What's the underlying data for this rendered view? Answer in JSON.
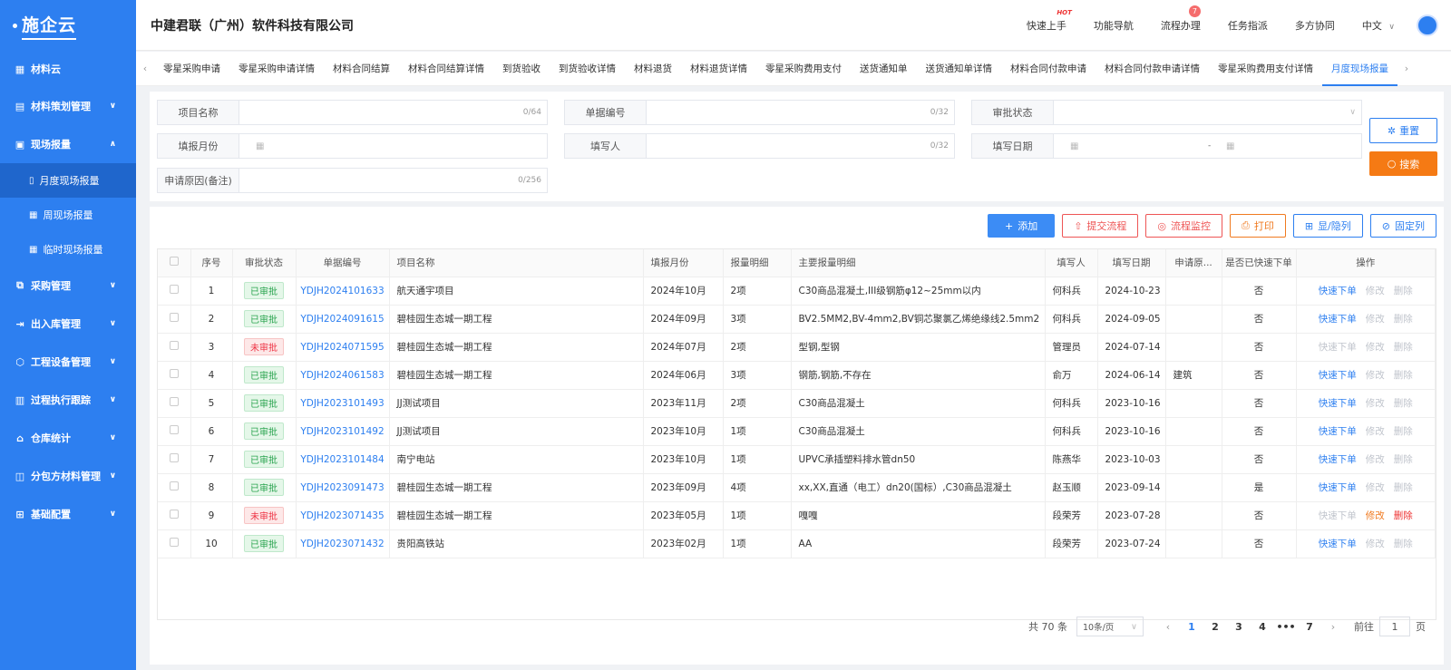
{
  "app": {
    "logo": "施企云",
    "company": "中建君联（广州）软件科技有限公司"
  },
  "header": {
    "items": [
      "快速上手",
      "功能导航",
      "流程办理",
      "任务指派",
      "多方协同"
    ],
    "hot_label": "HOT",
    "badge_count": "7",
    "language": "中文"
  },
  "sidebar": {
    "top": "材料云",
    "items": [
      "材料策划管理",
      "现场报量",
      "采购管理",
      "出入库管理",
      "工程设备管理",
      "过程执行跟踪",
      "仓库统计",
      "分包方材料管理",
      "基础配置"
    ],
    "subitems": [
      "月度现场报量",
      "周现场报量",
      "临时现场报量"
    ]
  },
  "tabs": [
    "零星采购申请",
    "零星采购申请详情",
    "材料合同结算",
    "材料合同结算详情",
    "到货验收",
    "到货验收详情",
    "材料退货",
    "材料退货详情",
    "零星采购费用支付",
    "送货通知单",
    "送货通知单详情",
    "材料合同付款申请",
    "材料合同付款申请详情",
    "零星采购费用支付详情",
    "月度现场报量"
  ],
  "filters": {
    "project_name": "项目名称",
    "project_count": "0/64",
    "doc_no": "单据编号",
    "doc_count": "0/32",
    "approval_status": "审批状态",
    "month": "填报月份",
    "filler": "填写人",
    "filler_count": "0/32",
    "fill_date": "填写日期",
    "date_sep": "-",
    "reason": "申请原因(备注)",
    "reason_count": "0/256",
    "reset": "重置",
    "search": "搜索"
  },
  "toolbar": {
    "add": "添加",
    "submit": "提交流程",
    "monitor": "流程监控",
    "print": "打印",
    "toggle": "显/隐列",
    "fix": "固定列"
  },
  "table": {
    "headers": [
      "序号",
      "审批状态",
      "单据编号",
      "项目名称",
      "填报月份",
      "报量明细",
      "主要报量明细",
      "填写人",
      "填写日期",
      "申请原...",
      "是否已快速下单",
      "操作"
    ],
    "actions": [
      "快速下单",
      "修改",
      "删除"
    ],
    "rows": [
      {
        "n": "1",
        "status": "已审批",
        "no": "YDJH2024101633",
        "project": "航天通宇项目",
        "month": "2024年10月",
        "qty": "2项",
        "detail": "C30商品混凝土,III级钢筋φ12~25mm以内",
        "filler": "何科兵",
        "date": "2024-10-23",
        "reason": "",
        "quick": "否"
      },
      {
        "n": "2",
        "status": "已审批",
        "no": "YDJH2024091615",
        "project": "碧桂园生态城一期工程",
        "month": "2024年09月",
        "qty": "3项",
        "detail": "BV2.5MM2,BV-4mm2,BV铜芯聚氯乙烯绝缘线2.5mm2",
        "filler": "何科兵",
        "date": "2024-09-05",
        "reason": "",
        "quick": "否"
      },
      {
        "n": "3",
        "status": "未审批",
        "no": "YDJH2024071595",
        "project": "碧桂园生态城一期工程",
        "month": "2024年07月",
        "qty": "2项",
        "detail": "型钢,型钢",
        "filler": "管理员",
        "date": "2024-07-14",
        "reason": "",
        "quick": "否"
      },
      {
        "n": "4",
        "status": "已审批",
        "no": "YDJH2024061583",
        "project": "碧桂园生态城一期工程",
        "month": "2024年06月",
        "qty": "3项",
        "detail": "钢筋,钢筋,不存在",
        "filler": "俞万",
        "date": "2024-06-14",
        "reason": "建筑",
        "quick": "否"
      },
      {
        "n": "5",
        "status": "已审批",
        "no": "YDJH2023101493",
        "project": "JJ测试项目",
        "month": "2023年11月",
        "qty": "2项",
        "detail": "C30商品混凝土",
        "filler": "何科兵",
        "date": "2023-10-16",
        "reason": "",
        "quick": "否"
      },
      {
        "n": "6",
        "status": "已审批",
        "no": "YDJH2023101492",
        "project": "JJ测试项目",
        "month": "2023年10月",
        "qty": "1项",
        "detail": "C30商品混凝土",
        "filler": "何科兵",
        "date": "2023-10-16",
        "reason": "",
        "quick": "否"
      },
      {
        "n": "7",
        "status": "已审批",
        "no": "YDJH2023101484",
        "project": "南宁电站",
        "month": "2023年10月",
        "qty": "1项",
        "detail": "UPVC承插塑料排水管dn50",
        "filler": "陈燕华",
        "date": "2023-10-03",
        "reason": "",
        "quick": "否"
      },
      {
        "n": "8",
        "status": "已审批",
        "no": "YDJH2023091473",
        "project": "碧桂园生态城一期工程",
        "month": "2023年09月",
        "qty": "4项",
        "detail": "xx,XX,直通（电工）dn20(国标）,C30商品混凝土",
        "filler": "赵玉顺",
        "date": "2023-09-14",
        "reason": "",
        "quick": "是"
      },
      {
        "n": "9",
        "status": "未审批",
        "no": "YDJH2023071435",
        "project": "碧桂园生态城一期工程",
        "month": "2023年05月",
        "qty": "1项",
        "detail": "嘎嘎",
        "filler": "段荣芳",
        "date": "2023-07-28",
        "reason": "",
        "quick": "否"
      },
      {
        "n": "10",
        "status": "已审批",
        "no": "YDJH2023071432",
        "project": "贵阳高铁站",
        "month": "2023年02月",
        "qty": "1项",
        "detail": "AA",
        "filler": "段荣芳",
        "date": "2023-07-24",
        "reason": "",
        "quick": "否"
      }
    ]
  },
  "pager": {
    "total": "共 70 条",
    "size": "10条/页",
    "pages": [
      "1",
      "2",
      "3",
      "4",
      "•••",
      "7"
    ],
    "goto": "前往",
    "page_input": "1",
    "page_unit": "页"
  }
}
